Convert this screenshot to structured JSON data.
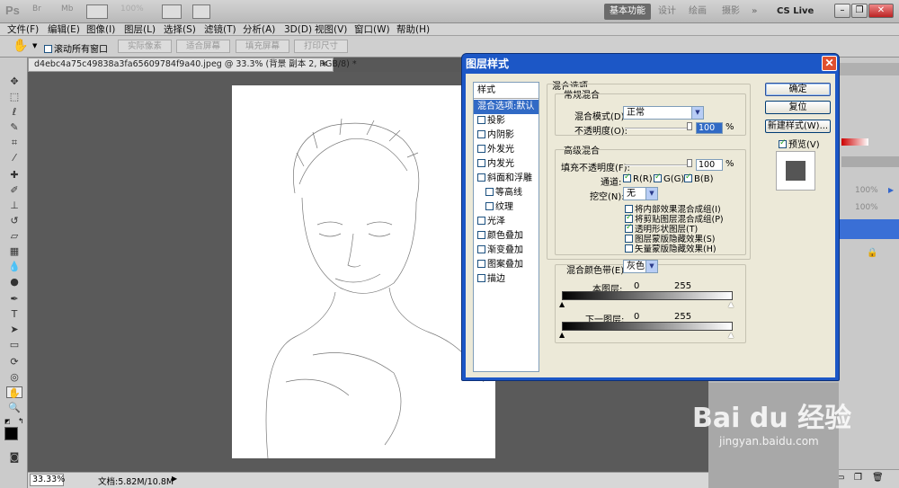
{
  "appbar": {
    "logo": "Ps",
    "br": "Br",
    "mb": "Mb",
    "zoom": "100%",
    "workspaces": [
      "基本功能",
      "设计",
      "绘画",
      "摄影"
    ],
    "more": "»",
    "cs_live": "CS Live"
  },
  "menu": [
    "文件(F)",
    "编辑(E)",
    "图像(I)",
    "图层(L)",
    "选择(S)",
    "滤镜(T)",
    "分析(A)",
    "3D(D)",
    "视图(V)",
    "窗口(W)",
    "帮助(H)"
  ],
  "options": {
    "scroll_all": "滚动所有窗口",
    "buttons": [
      "实际像素",
      "适合屏幕",
      "填充屏幕",
      "打印尺寸"
    ]
  },
  "document": {
    "tab_title": "d4ebc4a75c49838a3fa65609784f9a40.jpeg @ 33.3% (背景 副本 2, RGB/8) *",
    "zoom": "33.33%",
    "doc_info": "文档:5.82M/10.8M"
  },
  "panels": {
    "opacity_1": "100%",
    "opacity_2": "100%"
  },
  "dialog": {
    "title": "图层样式",
    "styles_header": "样式",
    "styles": [
      {
        "label": "混合选项:默认",
        "selected": true,
        "checkbox": false,
        "indent": false
      },
      {
        "label": "投影",
        "checkbox": true,
        "indent": false
      },
      {
        "label": "内阴影",
        "checkbox": true,
        "indent": false
      },
      {
        "label": "外发光",
        "checkbox": true,
        "indent": false
      },
      {
        "label": "内发光",
        "checkbox": true,
        "indent": false
      },
      {
        "label": "斜面和浮雕",
        "checkbox": true,
        "indent": false
      },
      {
        "label": "等高线",
        "checkbox": true,
        "indent": true
      },
      {
        "label": "纹理",
        "checkbox": true,
        "indent": true
      },
      {
        "label": "光泽",
        "checkbox": true,
        "indent": false
      },
      {
        "label": "颜色叠加",
        "checkbox": true,
        "indent": false
      },
      {
        "label": "渐变叠加",
        "checkbox": true,
        "indent": false
      },
      {
        "label": "图案叠加",
        "checkbox": true,
        "indent": false
      },
      {
        "label": "描边",
        "checkbox": true,
        "indent": false
      }
    ],
    "blend_options": "混合选项",
    "general_blending": "常规混合",
    "blend_mode_label": "混合模式(D):",
    "blend_mode_value": "正常",
    "opacity_label": "不透明度(O):",
    "opacity_value": "100",
    "percent": "%",
    "advanced_blending": "高级混合",
    "fill_opacity_label": "填充不透明度(F):",
    "fill_opacity_value": "100",
    "channels_label": "通道:",
    "channels": [
      "R(R)",
      "G(G)",
      "B(B)"
    ],
    "knockout_label": "挖空(N):",
    "knockout_value": "无",
    "checks": [
      {
        "label": "将内部效果混合成组(I)",
        "checked": false
      },
      {
        "label": "将剪贴图层混合成组(P)",
        "checked": true
      },
      {
        "label": "透明形状图层(T)",
        "checked": true
      },
      {
        "label": "图层蒙版隐藏效果(S)",
        "checked": false
      },
      {
        "label": "矢量蒙版隐藏效果(H)",
        "checked": false
      }
    ],
    "blend_if_label": "混合颜色带(E):",
    "blend_if_value": "灰色",
    "this_layer_label": "本图层:",
    "underlying_label": "下一图层:",
    "range_min": "0",
    "range_max": "255",
    "ok": "确定",
    "reset": "复位",
    "new_style": "新建样式(W)...",
    "preview": "预览(V)"
  },
  "watermark": {
    "text": "Bai du 经验",
    "url": "jingyan.baidu.com"
  }
}
